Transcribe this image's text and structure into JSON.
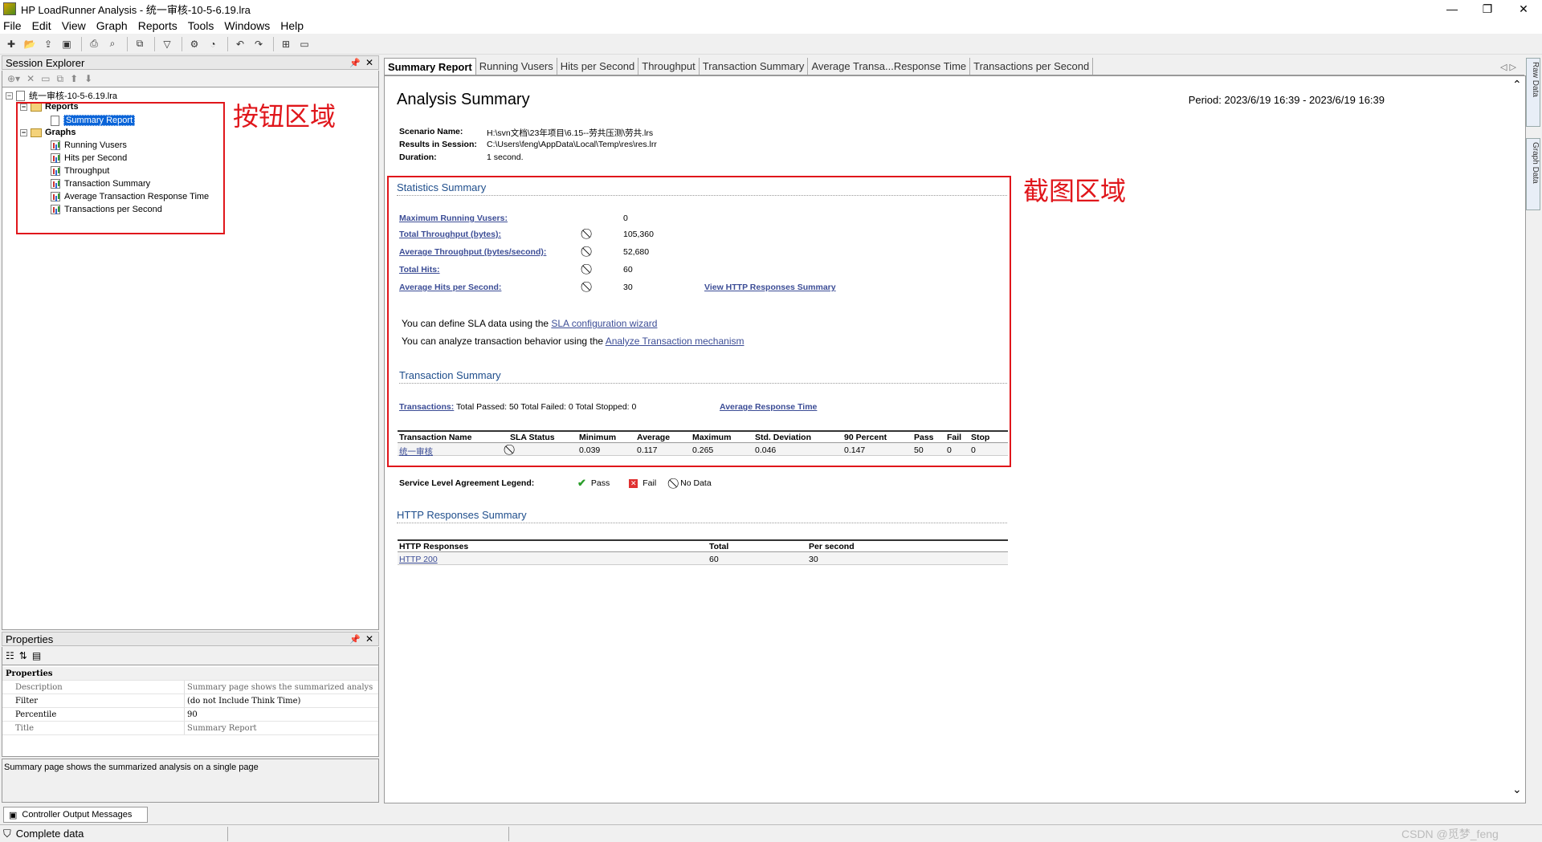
{
  "window": {
    "title": "HP LoadRunner Analysis - 统一审核-10-5-6.19.lra"
  },
  "menu": [
    "File",
    "Edit",
    "View",
    "Graph",
    "Reports",
    "Tools",
    "Windows",
    "Help"
  ],
  "session_explorer": {
    "title": "Session Explorer",
    "root": "统一审核-10-5-6.19.lra",
    "reports_label": "Reports",
    "summary_report": "Summary Report",
    "graphs_label": "Graphs",
    "graphs": [
      "Running Vusers",
      "Hits per Second",
      "Throughput",
      "Transaction Summary",
      "Average Transaction Response Time",
      "Transactions per Second"
    ]
  },
  "annotations": {
    "buttons": "按钮区域",
    "screenshot": "截图区域"
  },
  "properties": {
    "title": "Properties",
    "group": "Properties",
    "rows": [
      {
        "k": "Description",
        "v": "Summary page shows the summarized analys"
      },
      {
        "k": "Filter",
        "v": "(do not Include Think Time)"
      },
      {
        "k": "Percentile",
        "v": "90"
      },
      {
        "k": "Title",
        "v": "Summary Report"
      }
    ],
    "description": "Summary page shows the summarized analysis on a single page"
  },
  "bottom_tab": "Controller Output Messages",
  "status": "Complete data",
  "tabs": [
    "Summary Report",
    "Running Vusers",
    "Hits per Second",
    "Throughput",
    "Transaction Summary",
    "Average Transa...Response Time",
    "Transactions per Second"
  ],
  "side_tabs": [
    "Raw Data",
    "Graph Data"
  ],
  "report": {
    "title": "Analysis Summary",
    "period": "Period: 2023/6/19 16:39 - 2023/6/19 16:39",
    "scenario_name_label": "Scenario Name:",
    "scenario_name": "H:\\svn文档\\23年项目\\6.15--劳共压测\\劳共.lrs",
    "results_label": "Results in Session:",
    "results": "C:\\Users\\feng\\AppData\\Local\\Temp\\res\\res.lrr",
    "duration_label": "Duration:",
    "duration": "1 second.",
    "stats_title": "Statistics Summary",
    "stats": [
      {
        "label": "Maximum Running Vusers:",
        "value": "0",
        "icon": false
      },
      {
        "label": "Total Throughput (bytes):",
        "value": "105,360",
        "icon": true
      },
      {
        "label": "Average Throughput (bytes/second):",
        "value": "52,680",
        "icon": true
      },
      {
        "label": "Total Hits:",
        "value": "60",
        "icon": true
      },
      {
        "label": "Average Hits per Second:",
        "value": "30",
        "icon": true
      }
    ],
    "view_http": "View HTTP Responses Summary",
    "sla_text": "You can define SLA data using the ",
    "sla_link": "SLA configuration wizard",
    "analyze_text": "You can analyze transaction behavior using the ",
    "analyze_link": "Analyze Transaction mechanism",
    "trans_title": "Transaction Summary",
    "trans_link": "Transactions:",
    "trans_counts": "Total Passed: 50 Total Failed: 0 Total Stopped: 0",
    "avg_resp_link": "Average Response Time",
    "trans_headers": [
      "Transaction Name",
      "SLA Status",
      "Minimum",
      "Average",
      "Maximum",
      "Std. Deviation",
      "90 Percent",
      "Pass",
      "Fail",
      "Stop"
    ],
    "trans_row": [
      "统一审核",
      "",
      "0.039",
      "0.117",
      "0.265",
      "0.046",
      "0.147",
      "50",
      "0",
      "0"
    ],
    "legend_label": "Service Level Agreement Legend:",
    "legend": [
      "Pass",
      "Fail",
      "No Data"
    ],
    "http_title": "HTTP Responses Summary",
    "http_headers": [
      "HTTP Responses",
      "Total",
      "Per second"
    ],
    "http_row": [
      "HTTP 200",
      "60",
      "30"
    ]
  },
  "watermark": "CSDN @觅梦_feng"
}
